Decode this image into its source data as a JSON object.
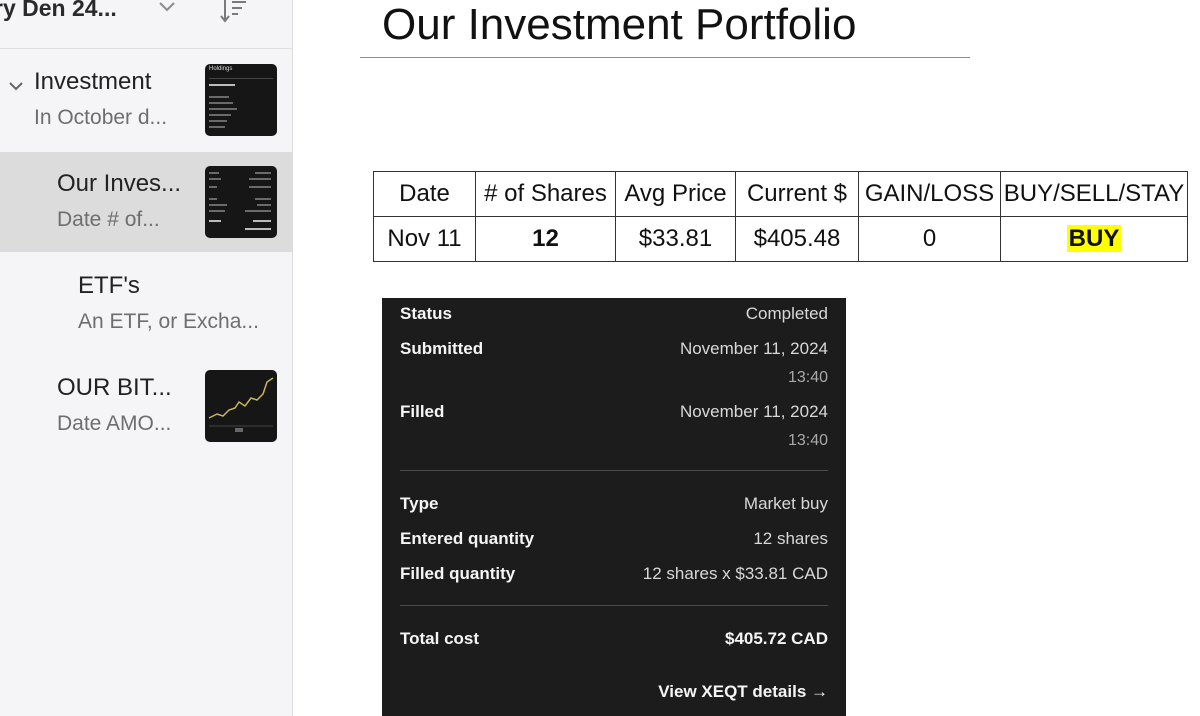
{
  "sidebar": {
    "folder_title": "ry Den 24...",
    "notes": [
      {
        "title": "Investment",
        "subtitle": "In October d...",
        "thumbnail": "holdings-screenshot",
        "expanded": true
      },
      {
        "title": "Our Inves...",
        "subtitle": "Date  # of...",
        "thumbnail": "order-receipt-screenshot",
        "selected": true
      },
      {
        "title": "ETF's",
        "subtitle": "An ETF, or Excha..."
      },
      {
        "title": "OUR BIT...",
        "subtitle": "Date  AMO...",
        "thumbnail": "price-chart-screenshot"
      }
    ],
    "thumb_holdings_label": "Holdings"
  },
  "document": {
    "title": "Our Investment Portfolio",
    "table": {
      "headers": [
        "Date",
        "# of Shares",
        "Avg Price",
        "Current $",
        "GAIN/LOSS",
        "BUY/SELL/STAY"
      ],
      "rows": [
        {
          "date": "Nov 11",
          "shares": "12",
          "avg_price": "$33.81",
          "current": "$405.48",
          "gain_loss": "0",
          "action": "BUY"
        }
      ]
    }
  },
  "receipt": {
    "status_label": "Status",
    "status_value": "Completed",
    "submitted_label": "Submitted",
    "submitted_date": "November 11, 2024",
    "submitted_time": "13:40",
    "filled_label": "Filled",
    "filled_date": "November 11, 2024",
    "filled_time": "13:40",
    "type_label": "Type",
    "type_value": "Market buy",
    "entered_qty_label": "Entered quantity",
    "entered_qty_value": "12 shares",
    "filled_qty_label": "Filled quantity",
    "filled_qty_value": "12 shares x $33.81 CAD",
    "total_label": "Total cost",
    "total_value": "$405.72 CAD",
    "details_link": "View XEQT details →"
  },
  "colors": {
    "sidebar_bg": "#f5f5f7",
    "selected_bg": "#dcdcdc",
    "receipt_bg": "#1c1c1c",
    "highlight": "#ffff00"
  }
}
